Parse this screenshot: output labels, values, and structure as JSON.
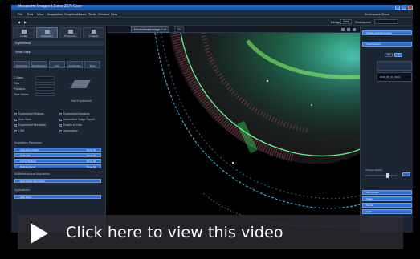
{
  "app": {
    "window_title": "Mosaic/mi Images | Zeiss ZEN Core"
  },
  "menu": [
    "File",
    "Edit",
    "View",
    "Acquisition",
    "Graphics",
    "Macro",
    "Tools",
    "Window",
    "Help"
  ],
  "workspace": {
    "label_zoom": "Workspace Zoom",
    "label_design": "Design",
    "design_value": "Dark",
    "label_workspace": "Workspace"
  },
  "mode_tabs": [
    "Locate",
    "Acquisition",
    "Processing",
    "Analysis"
  ],
  "left_panel": {
    "experiment_label": "Experiment1",
    "smart_setup": "Smart Setup",
    "buttons": [
      "Find Focus",
      "Set Exposure",
      "Live",
      "Continuous",
      "Snap"
    ],
    "fields": [
      {
        "label": "Z-Stack",
        "value": ""
      },
      {
        "label": "Tiles",
        "value": ""
      },
      {
        "label": "Positions",
        "value": ""
      },
      {
        "label": "Time Series",
        "value": ""
      }
    ],
    "start_experiment": "Start Experiment",
    "options": [
      "Experiment Regions",
      "Experiment Designer",
      "Auto Save",
      "Automated Image Export",
      "Experiment Feedback",
      "Enable AI Fast",
      "LSM",
      "Automation"
    ],
    "acquisition_parameter_title": "Acquisition Parameter",
    "acquisition_bars": [
      {
        "label": "Acquisition Mode",
        "right": "Show All"
      },
      {
        "label": "Channels",
        "right": "Show All"
      },
      {
        "label": "Focus Strategy",
        "right": "Show All"
      },
      {
        "label": "Definite Focus",
        "right": "Show All"
      }
    ],
    "multidim_title": "Multidimensional Acquisition",
    "multidim_bars": [
      {
        "label": "Experiment Information",
        "right": ""
      }
    ],
    "applications_title": "Applications",
    "applications_bars": [
      {
        "label": "Auto Save",
        "right": ""
      }
    ]
  },
  "view_tabs": [
    {
      "label": "Mosaic/Insect Image 1.czi",
      "active": true
    },
    {
      "label": "2D",
      "active": false
    }
  ],
  "right_panel": {
    "images_header": "Images and Documents",
    "snap_header": "Snap/Acquire",
    "thumb_items": [
      {
        "label": "",
        "selected": true
      },
      {
        "label": "2018_05_01_0001",
        "selected": false
      }
    ],
    "size_label": "Change Opacity",
    "tag_a": "Off",
    "tag_b": "On",
    "lower_headers": [
      "Microscope",
      "Stage",
      "Focus",
      "Light"
    ],
    "lower_tags": [
      "Show All",
      "Show All"
    ]
  },
  "video": {
    "label": "Click here to view this video",
    "play_icon": "play-icon"
  },
  "colors": {
    "accent": "#3d7fe0",
    "panel_bg": "#1c2532",
    "tissue_green": "#3cff7a",
    "tissue_cyan": "#4fd2ff",
    "tissue_red": "#c0404a"
  }
}
